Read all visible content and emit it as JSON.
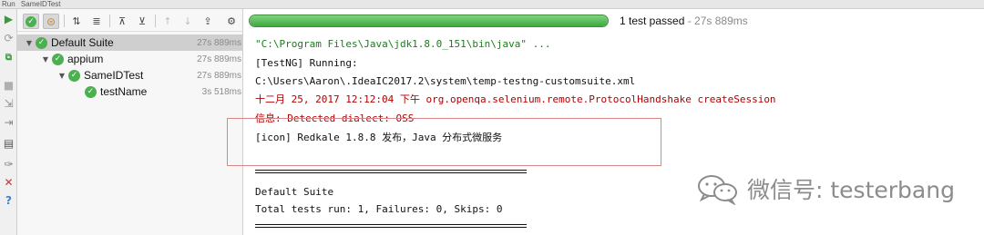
{
  "titlebar": {
    "run_label": "Run",
    "config_name": "SameIDTest"
  },
  "tree": {
    "nodes": [
      {
        "label": "Default Suite",
        "time": "27s 889ms"
      },
      {
        "label": "appium",
        "time": "27s 889ms"
      },
      {
        "label": "SameIDTest",
        "time": "27s 889ms"
      },
      {
        "label": "testName",
        "time": "3s 518ms"
      }
    ]
  },
  "status": {
    "progress_fraction": 1.0,
    "passed_text": "1 test passed",
    "duration_text": " - 27s 889ms"
  },
  "console": {
    "lines": [
      "\"C:\\Program Files\\Java\\jdk1.8.0_151\\bin\\java\" ...",
      "[TestNG] Running:",
      "  C:\\Users\\Aaron\\.IdeaIC2017.2\\system\\temp-testng-customsuite.xml",
      "十二月 25, 2017 12:12:04 下午 org.openqa.selenium.remote.ProtocolHandshake createSession",
      "信息: Detected dialect: OSS",
      "[icon] Redkale 1.8.8 发布，Java 分布式微服务",
      "Default Suite",
      "Total tests run: 1, Failures: 0, Skips: 0"
    ]
  },
  "watermark": {
    "text": "微信号: testerbang"
  },
  "colors": {
    "success": "#4caf50",
    "error_text": "#b00000",
    "command_text": "#1f7a1f",
    "highlight_box": "#d8868a"
  }
}
